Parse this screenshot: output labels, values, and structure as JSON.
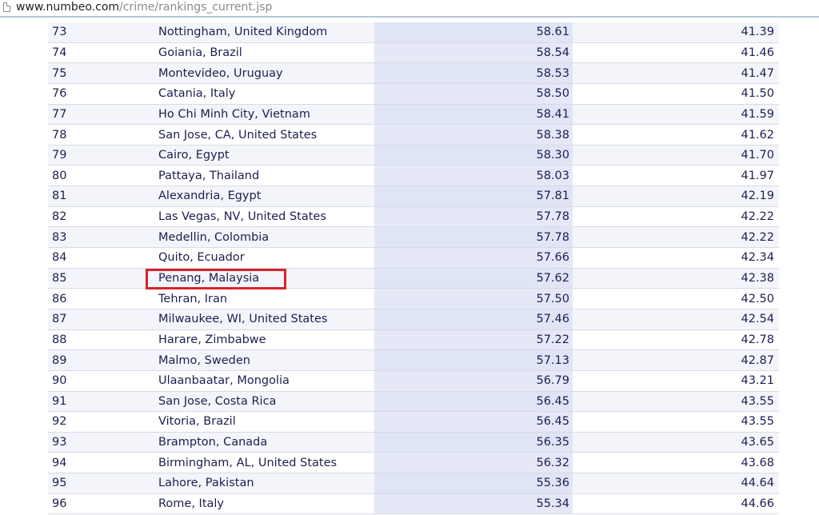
{
  "browser": {
    "url_host": "www.numbeo.com",
    "url_path": "/crime/rankings_current.jsp"
  },
  "ranking_table": {
    "rows": [
      {
        "rank": "73",
        "city": "Nottingham, United Kingdom",
        "crime_index": "58.61",
        "safety_index": "41.39"
      },
      {
        "rank": "74",
        "city": "Goiania, Brazil",
        "crime_index": "58.54",
        "safety_index": "41.46"
      },
      {
        "rank": "75",
        "city": "Montevideo, Uruguay",
        "crime_index": "58.53",
        "safety_index": "41.47"
      },
      {
        "rank": "76",
        "city": "Catania, Italy",
        "crime_index": "58.50",
        "safety_index": "41.50"
      },
      {
        "rank": "77",
        "city": "Ho Chi Minh City, Vietnam",
        "crime_index": "58.41",
        "safety_index": "41.59"
      },
      {
        "rank": "78",
        "city": "San Jose, CA, United States",
        "crime_index": "58.38",
        "safety_index": "41.62"
      },
      {
        "rank": "79",
        "city": "Cairo, Egypt",
        "crime_index": "58.30",
        "safety_index": "41.70"
      },
      {
        "rank": "80",
        "city": "Pattaya, Thailand",
        "crime_index": "58.03",
        "safety_index": "41.97"
      },
      {
        "rank": "81",
        "city": "Alexandria, Egypt",
        "crime_index": "57.81",
        "safety_index": "42.19"
      },
      {
        "rank": "82",
        "city": "Las Vegas, NV, United States",
        "crime_index": "57.78",
        "safety_index": "42.22"
      },
      {
        "rank": "83",
        "city": "Medellin, Colombia",
        "crime_index": "57.78",
        "safety_index": "42.22"
      },
      {
        "rank": "84",
        "city": "Quito, Ecuador",
        "crime_index": "57.66",
        "safety_index": "42.34"
      },
      {
        "rank": "85",
        "city": "Penang, Malaysia",
        "crime_index": "57.62",
        "safety_index": "42.38"
      },
      {
        "rank": "86",
        "city": "Tehran, Iran",
        "crime_index": "57.50",
        "safety_index": "42.50"
      },
      {
        "rank": "87",
        "city": "Milwaukee, WI, United States",
        "crime_index": "57.46",
        "safety_index": "42.54"
      },
      {
        "rank": "88",
        "city": "Harare, Zimbabwe",
        "crime_index": "57.22",
        "safety_index": "42.78"
      },
      {
        "rank": "89",
        "city": "Malmo, Sweden",
        "crime_index": "57.13",
        "safety_index": "42.87"
      },
      {
        "rank": "90",
        "city": "Ulaanbaatar, Mongolia",
        "crime_index": "56.79",
        "safety_index": "43.21"
      },
      {
        "rank": "91",
        "city": "San Jose, Costa Rica",
        "crime_index": "56.45",
        "safety_index": "43.55"
      },
      {
        "rank": "92",
        "city": "Vitoria, Brazil",
        "crime_index": "56.45",
        "safety_index": "43.55"
      },
      {
        "rank": "93",
        "city": "Brampton, Canada",
        "crime_index": "56.35",
        "safety_index": "43.65"
      },
      {
        "rank": "94",
        "city": "Birmingham, AL, United States",
        "crime_index": "56.32",
        "safety_index": "43.68"
      },
      {
        "rank": "95",
        "city": "Lahore, Pakistan",
        "crime_index": "55.36",
        "safety_index": "44.64"
      },
      {
        "rank": "96",
        "city": "Rome, Italy",
        "crime_index": "55.34",
        "safety_index": "44.66"
      }
    ],
    "highlighted_row": "85"
  },
  "colors": {
    "highlight_border": "#d9222c",
    "row_text": "#1c1f4f",
    "index_column_bg": "#e4e8f7"
  },
  "icons": {
    "page": "page-icon"
  }
}
